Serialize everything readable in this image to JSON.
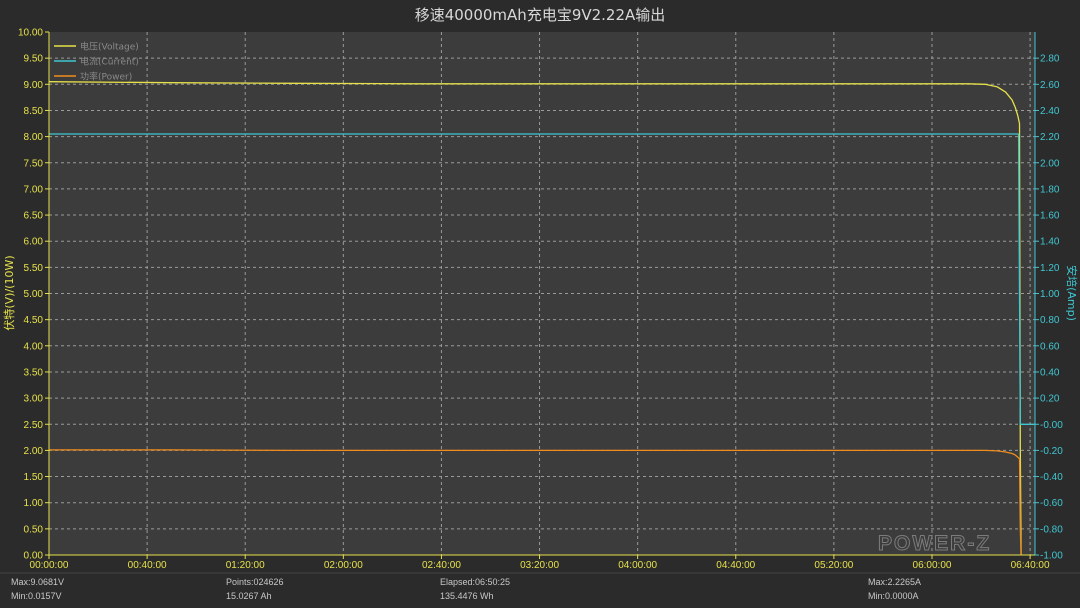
{
  "chart_data": {
    "type": "line",
    "title": "移速40000mAh充电宝9V2.22A输出",
    "xlabel": "",
    "ylabel_left": "伏特(V)/(10W)",
    "ylabel_right": "安培(Amp)",
    "x_unit": "seconds",
    "xlim": [
      0,
      24120
    ],
    "ylim_left": [
      0,
      10
    ],
    "ylim_right": [
      -1,
      3
    ],
    "x_tick_labels": [
      "00:00:00",
      "00:40:00",
      "01:20:00",
      "02:00:00",
      "02:40:00",
      "03:20:00",
      "04:00:00",
      "04:40:00",
      "05:20:00",
      "06:00:00",
      "06:40:00"
    ],
    "x_ticks": [
      0,
      2400,
      4800,
      7200,
      9600,
      12000,
      14400,
      16800,
      19200,
      21600,
      24000
    ],
    "y_left_ticks": [
      0.0,
      0.5,
      1.0,
      1.5,
      2.0,
      2.5,
      3.0,
      3.5,
      4.0,
      4.5,
      5.0,
      5.5,
      6.0,
      6.5,
      7.0,
      7.5,
      8.0,
      8.5,
      9.0,
      9.5,
      10.0
    ],
    "y_left_tick_labels": [
      "0.00",
      "0.50",
      "1.00",
      "1.50",
      "2.00",
      "2.50",
      "3.00",
      "3.50",
      "4.00",
      "4.50",
      "5.00",
      "5.50",
      "6.00",
      "6.50",
      "7.00",
      "7.50",
      "8.00",
      "8.50",
      "9.00",
      "9.50",
      "10.00"
    ],
    "y_right_ticks": [
      -1.0,
      -0.8,
      -0.6,
      -0.4,
      -0.2,
      0.0,
      0.2,
      0.4,
      0.6,
      0.8,
      1.0,
      1.2,
      1.4,
      1.6,
      1.8,
      2.0,
      2.2,
      2.4,
      2.6,
      2.8
    ],
    "y_right_tick_labels": [
      "-1.00",
      "-0.80",
      "-0.60",
      "-0.40",
      "-0.20",
      "-0.00",
      "0.20",
      "0.40",
      "0.60",
      "0.80",
      "1.00",
      "1.20",
      "1.40",
      "1.60",
      "1.80",
      "2.00",
      "2.20",
      "2.40",
      "2.60",
      "2.80"
    ],
    "grid": true,
    "legend_position": "top-left",
    "series": [
      {
        "name": "电压(Voltage)",
        "axis": "left",
        "color": "#e6e14a",
        "x": [
          0,
          3000,
          6000,
          9000,
          12000,
          15000,
          18000,
          21000,
          22500,
          22900,
          23200,
          23400,
          23560,
          23640,
          23700,
          23740,
          23760,
          23780
        ],
        "y": [
          9.05,
          9.03,
          9.02,
          9.01,
          9.01,
          9.01,
          9.01,
          9.01,
          9.01,
          9.0,
          8.95,
          8.85,
          8.7,
          8.55,
          8.4,
          8.25,
          2.0,
          0.02
        ]
      },
      {
        "name": "电流(Current)",
        "axis": "right",
        "color": "#3fc7d2",
        "x": [
          0,
          3000,
          6000,
          9000,
          12000,
          15000,
          18000,
          21000,
          22500,
          23000,
          23500,
          23720,
          23740,
          23760,
          24100
        ],
        "y": [
          2.22,
          2.22,
          2.22,
          2.22,
          2.22,
          2.22,
          2.22,
          2.22,
          2.22,
          2.22,
          2.22,
          2.22,
          1.0,
          0.0,
          0.0
        ]
      },
      {
        "name": "功率(Power)",
        "axis": "left",
        "color": "#f08c1e",
        "x": [
          0,
          3000,
          6000,
          9000,
          12000,
          15000,
          18000,
          21000,
          22500,
          22900,
          23200,
          23400,
          23560,
          23640,
          23700,
          23740,
          23760,
          23780
        ],
        "y": [
          2.01,
          2.01,
          2.0,
          2.0,
          2.0,
          2.0,
          2.0,
          2.0,
          2.0,
          2.0,
          1.99,
          1.97,
          1.94,
          1.91,
          1.87,
          1.84,
          0.5,
          0.0
        ]
      }
    ]
  },
  "status": {
    "max_voltage": "Max:9.0681V",
    "min_voltage": "Min:0.0157V",
    "points": "Points:024626",
    "capacity_ah": "15.0267 Ah",
    "elapsed": "Elapsed:06:50:25",
    "energy_wh": "135.4476 Wh",
    "max_current": "Max:2.2265A",
    "min_current": "Min:0.0000A"
  },
  "colors": {
    "background": "#2b2b2b",
    "plot_background": "#3c3c3c",
    "grid": "#9a9a9a",
    "left_axis": "#e6e14a",
    "right_axis": "#3fc7d2"
  },
  "watermark": "POWER-Z"
}
